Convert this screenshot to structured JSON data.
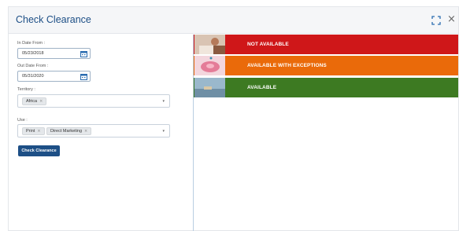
{
  "dialog": {
    "title": "Check Clearance"
  },
  "icons": {
    "expand": "expand-icon",
    "close": "close-icon",
    "calendar": "calendar-icon",
    "chip_remove": "remove-chip-icon",
    "dropdown": "chevron-down-icon"
  },
  "icon_glyphs": {
    "close": "×",
    "chip_remove": "×",
    "caret": "▾"
  },
  "form": {
    "in_date_label": "In Date From :",
    "in_date_value": "05/23/2018",
    "out_date_label": "Out Date From :",
    "out_date_value": "05/31/2020",
    "territory_label": "Territory :",
    "territory_chips": [
      "Africa"
    ],
    "use_label": "Use :",
    "use_chips": [
      "Print",
      "Direct Marketing"
    ],
    "submit_label": "Check Clearance"
  },
  "results": [
    {
      "label": "NOT AVAILABLE",
      "color": "#cf1719"
    },
    {
      "label": "AVAILABLE WITH EXCEPTIONS",
      "color": "#ea6a0a"
    },
    {
      "label": "AVAILABLE",
      "color": "#3d7a22"
    }
  ],
  "colors": {
    "title": "#1d4f86",
    "button": "#1d4f86",
    "divider": "#b9cde2"
  }
}
